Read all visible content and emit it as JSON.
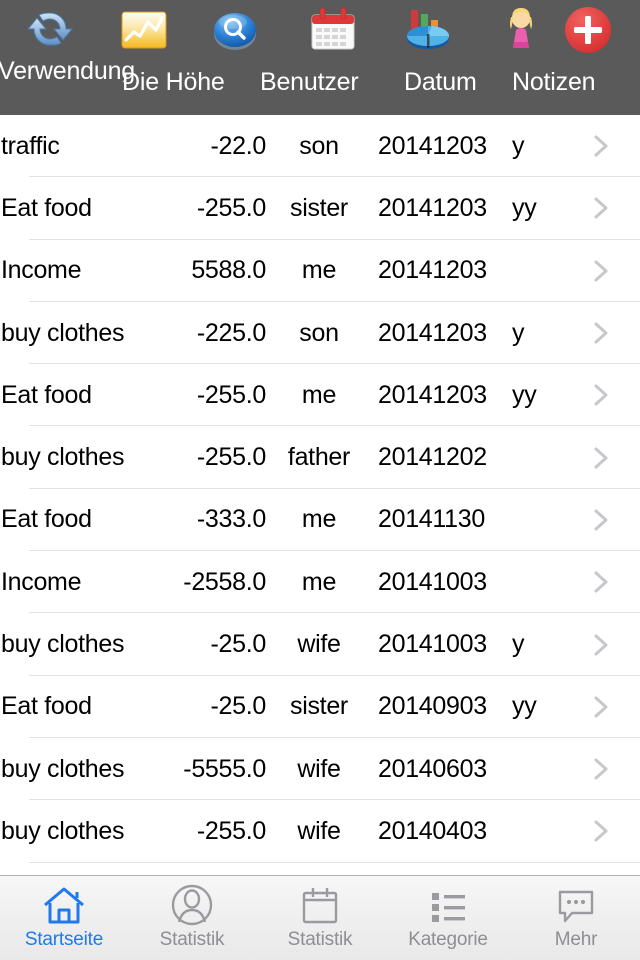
{
  "header": {
    "background_color": "#5a5a5a",
    "icons": [
      {
        "name": "refresh-icon",
        "label": "refresh"
      },
      {
        "name": "chart-icon",
        "label": "chart"
      },
      {
        "name": "search-icon",
        "label": "search"
      },
      {
        "name": "calendar-icon",
        "label": "calendar"
      },
      {
        "name": "pie-chart-icon",
        "label": "pie-chart"
      },
      {
        "name": "user-girl-icon",
        "label": "user"
      },
      {
        "name": "add-icon",
        "label": "add"
      }
    ],
    "columns": {
      "usage": "Verwendung",
      "amount": "Die Höhe",
      "user": "Benutzer",
      "date": "Datum",
      "notes": "Notizen"
    }
  },
  "list": {
    "rows": [
      {
        "usage": "traffic",
        "amount": "-22.0",
        "user": "son",
        "date": "20141203",
        "notes": "y"
      },
      {
        "usage": "Eat food",
        "amount": "-255.0",
        "user": "sister",
        "date": "20141203",
        "notes": "yy"
      },
      {
        "usage": "Income",
        "amount": "5588.0",
        "user": "me",
        "date": "20141203",
        "notes": ""
      },
      {
        "usage": "buy clothes",
        "amount": "-225.0",
        "user": "son",
        "date": "20141203",
        "notes": "y"
      },
      {
        "usage": "Eat food",
        "amount": "-255.0",
        "user": "me",
        "date": "20141203",
        "notes": "yy"
      },
      {
        "usage": "buy clothes",
        "amount": "-255.0",
        "user": "father",
        "date": "20141202",
        "notes": ""
      },
      {
        "usage": "Eat food",
        "amount": "-333.0",
        "user": "me",
        "date": "20141130",
        "notes": ""
      },
      {
        "usage": "Income",
        "amount": "-2558.0",
        "user": "me",
        "date": "20141003",
        "notes": ""
      },
      {
        "usage": "buy clothes",
        "amount": "-25.0",
        "user": "wife",
        "date": "20141003",
        "notes": "y"
      },
      {
        "usage": "Eat food",
        "amount": "-25.0",
        "user": "sister",
        "date": "20140903",
        "notes": "yy"
      },
      {
        "usage": "buy clothes",
        "amount": "-5555.0",
        "user": "wife",
        "date": "20140603",
        "notes": ""
      },
      {
        "usage": "buy clothes",
        "amount": "-255.0",
        "user": "wife",
        "date": "20140403",
        "notes": ""
      }
    ],
    "disclosure_icon": "chevron-right-icon"
  },
  "tabbar": {
    "active_color": "#1f7aeb",
    "inactive_color": "#8e8e93",
    "tabs": [
      {
        "label": "Startseite",
        "icon": "home-icon",
        "active": true
      },
      {
        "label": "Statistik",
        "icon": "person-icon",
        "active": false
      },
      {
        "label": "Statistik",
        "icon": "calendar-icon",
        "active": false
      },
      {
        "label": "Kategorie",
        "icon": "list-icon",
        "active": false
      },
      {
        "label": "Mehr",
        "icon": "more-chat-icon",
        "active": false
      }
    ]
  }
}
